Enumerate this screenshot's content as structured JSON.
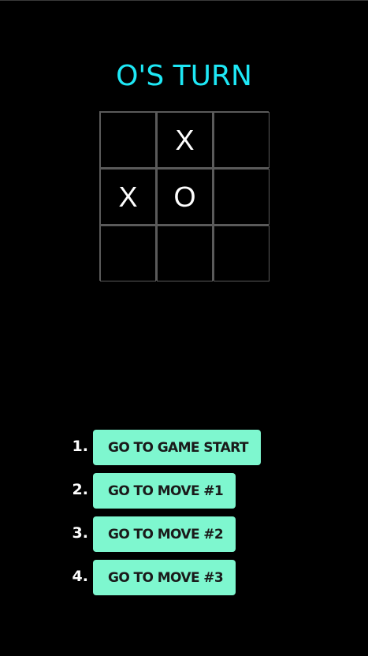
{
  "status": "O'S TURN",
  "board": [
    "",
    "X",
    "",
    "X",
    "O",
    "",
    "",
    "",
    ""
  ],
  "moves": [
    {
      "number": "1.",
      "label": "GO TO GAME START"
    },
    {
      "number": "2.",
      "label": "GO TO MOVE #1"
    },
    {
      "number": "3.",
      "label": "GO TO MOVE #2"
    },
    {
      "number": "4.",
      "label": "GO TO MOVE #3"
    }
  ],
  "colors": {
    "background": "#000000",
    "status_text": "#1ee8f6",
    "grid_lines": "#5a5a5a",
    "mark_text": "#ffffff",
    "button_bg": "#7ef7cf",
    "button_text": "#1a1a1a"
  }
}
